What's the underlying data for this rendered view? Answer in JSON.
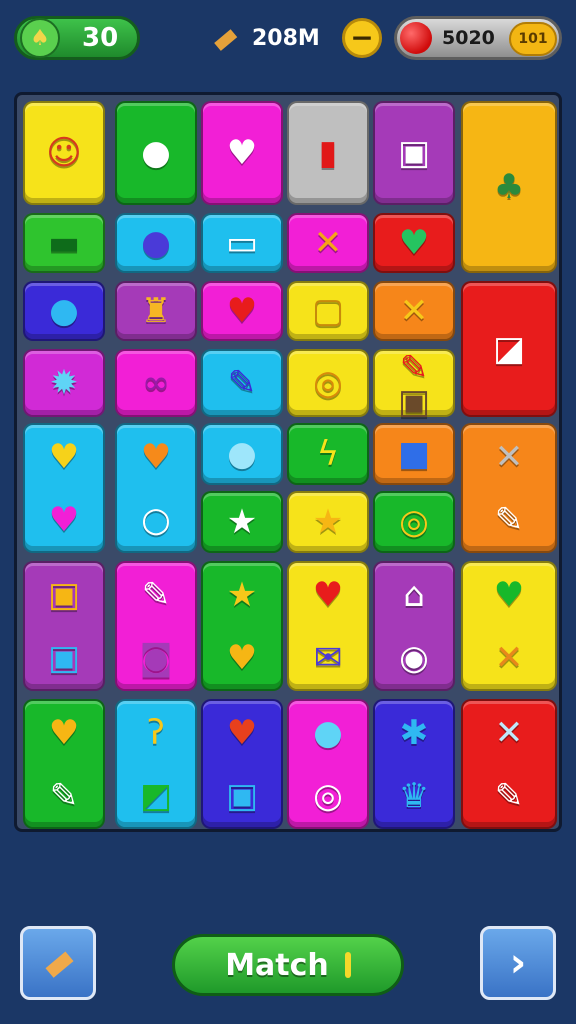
{
  "hud": {
    "level": {
      "value": "30",
      "icon": "leaf-icon"
    },
    "coins": {
      "value": "208M",
      "icon": "roll-icon"
    },
    "minus": {
      "symbol": "−"
    },
    "gems": {
      "value": "5020",
      "tag": "101"
    }
  },
  "board": {
    "tiles": [
      {
        "name": "tile-person-portrait",
        "color": "#f6e31a",
        "icons": [
          {
            "g": "☺",
            "name": "person-portrait-icon",
            "c": "#d63a1e"
          }
        ]
      },
      {
        "name": "tile-map-pin",
        "color": "#18b82a",
        "icons": [
          {
            "g": "●",
            "name": "map-pin-icon",
            "c": "#ffffff"
          }
        ]
      },
      {
        "name": "tile-heart-balloon",
        "color": "#f21fd6",
        "icons": [
          {
            "g": "♥",
            "name": "heart-balloon-icon",
            "c": "#ffffff"
          }
        ]
      },
      {
        "name": "tile-book",
        "color": "#bfbfbf",
        "icons": [
          {
            "g": "▮",
            "name": "open-book-icon",
            "c": "#e11818"
          }
        ]
      },
      {
        "name": "tile-camera",
        "color": "#a53ab8",
        "icons": [
          {
            "g": "▣",
            "name": "camera-icon",
            "c": "#ffffff"
          }
        ]
      },
      {
        "name": "tile-tree-emblem",
        "color": "#f6b614",
        "icons": [
          {
            "g": "♣",
            "name": "tree-emblem-icon",
            "c": "#2c8a3c"
          }
        ]
      },
      {
        "name": "tile-bandage",
        "color": "#2fc42e",
        "icons": [
          {
            "g": "▬",
            "name": "bandage-icon",
            "c": "#0e6c1a"
          }
        ]
      },
      {
        "name": "tile-orb",
        "color": "#1fbfee",
        "icons": [
          {
            "g": "●",
            "name": "orb-icon",
            "c": "#4a3ad8"
          }
        ]
      },
      {
        "name": "tile-scroll",
        "color": "#1fbfee",
        "icons": [
          {
            "g": "▭",
            "name": "scroll-icon",
            "c": "#ffffff"
          }
        ]
      },
      {
        "name": "tile-cross-orange",
        "color": "#f21fd6",
        "icons": [
          {
            "g": "✕",
            "name": "cross-icon",
            "c": "#f6a418"
          }
        ]
      },
      {
        "name": "tile-green-heart",
        "color": "#e81c1c",
        "icons": [
          {
            "g": "♥",
            "name": "heart-icon",
            "c": "#25c460"
          }
        ]
      },
      {
        "name": "tile-blue-circle",
        "color": "#3a2ad8",
        "icons": [
          {
            "g": "●",
            "name": "circle-icon",
            "c": "#2fb8f2"
          }
        ]
      },
      {
        "name": "tile-cupcake",
        "color": "#a53ab8",
        "icons": [
          {
            "g": "♜",
            "name": "cupcake-icon",
            "c": "#f6b624"
          }
        ]
      },
      {
        "name": "tile-red-heart",
        "color": "#f21fd6",
        "icons": [
          {
            "g": "♥",
            "name": "heart-icon",
            "c": "#e81c1c"
          }
        ]
      },
      {
        "name": "tile-ticket",
        "color": "#f6e31a",
        "icons": [
          {
            "g": "▢",
            "name": "ticket-icon",
            "c": "#c88a0a"
          }
        ]
      },
      {
        "name": "tile-x-shape",
        "color": "#f6861a",
        "icons": [
          {
            "g": "✕",
            "name": "x-shape-icon",
            "c": "#f6c81a"
          }
        ]
      },
      {
        "name": "tile-eraser",
        "color": "#e81c1c",
        "icons": [
          {
            "g": "◪",
            "name": "eraser-icon",
            "c": "#ffffff"
          }
        ]
      },
      {
        "name": "tile-burst",
        "color": "#d12ad6",
        "icons": [
          {
            "g": "✹",
            "name": "burst-icon",
            "c": "#5fd4f6"
          }
        ]
      },
      {
        "name": "tile-infinity",
        "color": "#f21fd6",
        "icons": [
          {
            "g": "∞",
            "name": "infinity-icon",
            "c": "#9a1aa8"
          }
        ]
      },
      {
        "name": "tile-edit-square",
        "color": "#1fbfee",
        "icons": [
          {
            "g": "✎",
            "name": "edit-square-icon",
            "c": "#3a2ad8"
          }
        ]
      },
      {
        "name": "tile-swirl-coin",
        "color": "#f6e31a",
        "icons": [
          {
            "g": "◎",
            "name": "swirl-coin-icon",
            "c": "#d88a0a"
          }
        ]
      },
      {
        "name": "tile-pencil-bag",
        "color": "#f6e31a",
        "icons": [
          {
            "g": "✎",
            "name": "pencil-icon",
            "c": "#e81c1c"
          },
          {
            "g": "▣",
            "name": "bag-icon",
            "c": "#6a4a2a"
          }
        ]
      },
      {
        "name": "tile-hearts-pair",
        "color": "#1fbfee",
        "icons": [
          {
            "g": "♥",
            "name": "heart-icon",
            "c": "#f6d21a"
          },
          {
            "g": "♥",
            "name": "heart-icon",
            "c": "#f21fd6"
          }
        ]
      },
      {
        "name": "tile-heart-ring",
        "color": "#1fbfee",
        "icons": [
          {
            "g": "♥",
            "name": "heart-icon",
            "c": "#f68a1a"
          },
          {
            "g": "○",
            "name": "ring-icon",
            "c": "#ffffff"
          }
        ]
      },
      {
        "name": "tile-speech-bubble",
        "color": "#1fbfee",
        "icons": [
          {
            "g": "●",
            "name": "speech-bubble-icon",
            "c": "#9ee6fb"
          }
        ]
      },
      {
        "name": "tile-bolt",
        "color": "#18b82a",
        "icons": [
          {
            "g": "ϟ",
            "name": "bolt-icon",
            "c": "#f6e31a"
          }
        ]
      },
      {
        "name": "tile-puzzle",
        "color": "#f6861a",
        "icons": [
          {
            "g": "■",
            "name": "puzzle-icon",
            "c": "#2f6ee8"
          }
        ]
      },
      {
        "name": "tile-star-white",
        "color": "#18b82a",
        "icons": [
          {
            "g": "★",
            "name": "star-icon",
            "c": "#ffffff"
          }
        ]
      },
      {
        "name": "tile-star-gold",
        "color": "#f6e31a",
        "icons": [
          {
            "g": "★",
            "name": "star-icon",
            "c": "#f6b614"
          }
        ]
      },
      {
        "name": "tile-knot",
        "color": "#18b82a",
        "icons": [
          {
            "g": "◎",
            "name": "knot-icon",
            "c": "#f6c81a"
          }
        ]
      },
      {
        "name": "tile-cross-pencil",
        "color": "#f6861a",
        "icons": [
          {
            "g": "✕",
            "name": "cross-icon",
            "c": "#bfbfbf"
          },
          {
            "g": "✎",
            "name": "pencil-icon",
            "c": "#ffffff"
          }
        ]
      },
      {
        "name": "tile-bag-camera",
        "color": "#a53ab8",
        "icons": [
          {
            "g": "▣",
            "name": "bag-icon",
            "c": "#f6b614"
          },
          {
            "g": "▣",
            "name": "camera-icon",
            "c": "#2fb8f2"
          }
        ]
      },
      {
        "name": "tile-pencil-safe",
        "color": "#f21fd6",
        "icons": [
          {
            "g": "✎",
            "name": "pencil-icon",
            "c": "#ffffff"
          },
          {
            "g": "◙",
            "name": "safe-icon",
            "c": "#a53ab8"
          }
        ]
      },
      {
        "name": "tile-star-heart",
        "color": "#18b82a",
        "icons": [
          {
            "g": "★",
            "name": "star-icon",
            "c": "#f6c81a"
          },
          {
            "g": "♥",
            "name": "heart-icon",
            "c": "#f6b614"
          }
        ]
      },
      {
        "name": "tile-heart-mail",
        "color": "#f6e31a",
        "icons": [
          {
            "g": "♥",
            "name": "heart-icon",
            "c": "#e81c1c"
          },
          {
            "g": "✉",
            "name": "mail-icon",
            "c": "#4a3ad8"
          }
        ]
      },
      {
        "name": "tile-house-donut",
        "color": "#a53ab8",
        "icons": [
          {
            "g": "⌂",
            "name": "house-icon",
            "c": "#ffffff"
          },
          {
            "g": "◉",
            "name": "donut-icon",
            "c": "#ffffff"
          }
        ]
      },
      {
        "name": "tile-heart-cross",
        "color": "#f6e31a",
        "icons": [
          {
            "g": "♥",
            "name": "heart-icon",
            "c": "#18b82a"
          },
          {
            "g": "✕",
            "name": "cross-icon",
            "c": "#e8881a"
          }
        ]
      },
      {
        "name": "tile-heart-pencil",
        "color": "#18b82a",
        "icons": [
          {
            "g": "♥",
            "name": "heart-icon",
            "c": "#f6b614"
          },
          {
            "g": "✎",
            "name": "pencil-icon",
            "c": "#ffffff"
          }
        ]
      },
      {
        "name": "tile-hook-ruler",
        "color": "#1fbfee",
        "icons": [
          {
            "g": "ʔ",
            "name": "hook-icon",
            "c": "#f6c81a"
          },
          {
            "g": "◩",
            "name": "ruler-icon",
            "c": "#18b82a"
          }
        ]
      },
      {
        "name": "tile-heart-case",
        "color": "#3a2ad8",
        "icons": [
          {
            "g": "♥",
            "name": "heart-icon",
            "c": "#e8401c"
          },
          {
            "g": "▣",
            "name": "case-icon",
            "c": "#2fb8f2"
          }
        ]
      },
      {
        "name": "tile-bubble-ring",
        "color": "#f21fd6",
        "icons": [
          {
            "g": "●",
            "name": "speech-bubble-icon",
            "c": "#5fd4f6"
          },
          {
            "g": "◎",
            "name": "ring-icon",
            "c": "#ffffff"
          }
        ]
      },
      {
        "name": "tile-gear-crown",
        "color": "#3a2ad8",
        "icons": [
          {
            "g": "✱",
            "name": "gear-icon",
            "c": "#2fb8f2"
          },
          {
            "g": "♛",
            "name": "crown-icon",
            "c": "#2fb8f2"
          }
        ]
      },
      {
        "name": "tile-x-pencil",
        "color": "#e81c1c",
        "icons": [
          {
            "g": "✕",
            "name": "x-shape-icon",
            "c": "#bfe8fb"
          },
          {
            "g": "✎",
            "name": "pencil-icon",
            "c": "#ffffff"
          }
        ]
      }
    ]
  },
  "footer": {
    "left_icon": "roll-icon",
    "match_label": "Match",
    "next_icon": "chevron-right-icon"
  }
}
